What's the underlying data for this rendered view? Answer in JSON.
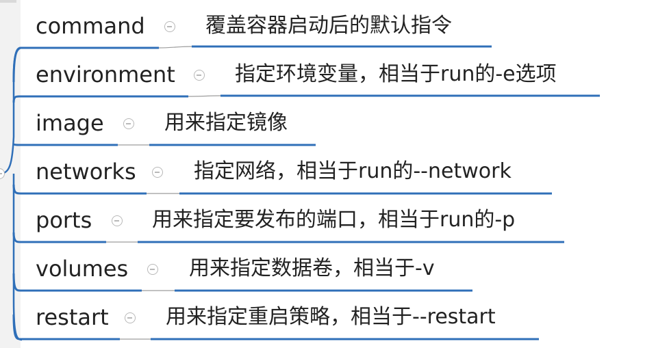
{
  "colors": {
    "line": "#2f6fb8",
    "text": "#222222",
    "toggle": "#b8b8b8"
  },
  "nodes": [
    {
      "key": "command",
      "desc": "覆盖容器启动后的默认指令"
    },
    {
      "key": "environment",
      "desc": "指定环境变量，相当于run的-e选项"
    },
    {
      "key": "image",
      "desc": "用来指定镜像"
    },
    {
      "key": "networks",
      "desc": "指定网络，相当于run的--network"
    },
    {
      "key": "ports",
      "desc": "用来指定要发布的端口，相当于run的-p"
    },
    {
      "key": "volumes",
      "desc": "用来指定数据卷，相当于-v"
    },
    {
      "key": "restart",
      "desc": "用来指定重启策略，相当于--restart"
    }
  ]
}
